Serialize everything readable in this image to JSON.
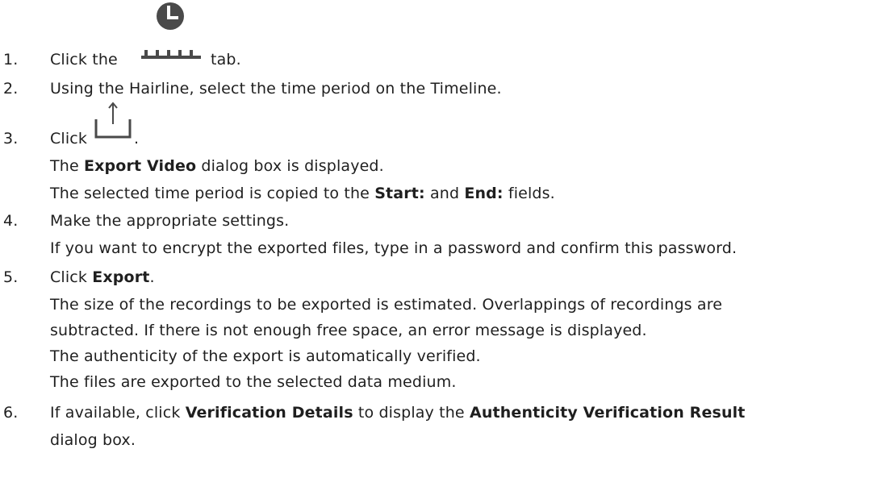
{
  "steps": [
    {
      "number": "1.",
      "pre": "Click the",
      "icon": "clock-timeline-tab-icon",
      "post": "tab."
    },
    {
      "number": "2.",
      "text": "Using the Hairline, select the time period on the Timeline."
    },
    {
      "number": "3.",
      "pre": "Click",
      "icon": "export-icon",
      "post": ".",
      "details": [
        {
          "pre": "The",
          "bold": "Export Video",
          "post": "dialog box is displayed."
        },
        {
          "pre": "The selected time period is copied to the",
          "bold1": "Start:",
          "mid": "and",
          "bold2": "End:",
          "post": "fields."
        }
      ]
    },
    {
      "number": "4.",
      "text": "Make the appropriate settings.",
      "details": [
        {
          "text": "If you want to encrypt the exported files, type in a password and confirm this password."
        }
      ]
    },
    {
      "number": "5.",
      "pre": "Click",
      "bold": "Export",
      "post": ".",
      "details": [
        {
          "text": "The size of the recordings to be exported is estimated. Overlappings of recordings are"
        },
        {
          "text": "subtracted. If there is not enough free space, an error message is displayed."
        },
        {
          "text": "The authenticity of the export is automatically verified."
        },
        {
          "text": "The files are exported to the selected data medium."
        }
      ]
    },
    {
      "number": "6.",
      "pre": "If available, click",
      "bold1": "Verification Details",
      "mid": "to display the",
      "bold2": "Authenticity Verification Result",
      "cont": "dialog box."
    }
  ]
}
